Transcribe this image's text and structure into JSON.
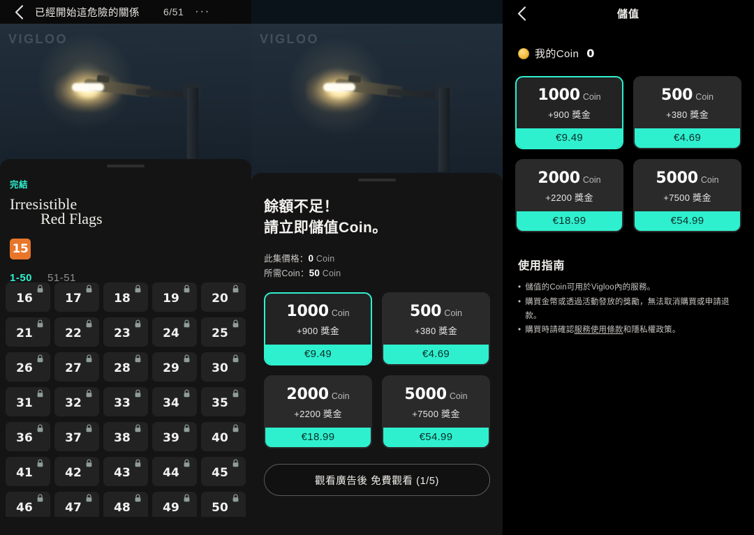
{
  "left_panel": {
    "topbar": {
      "back_icon": "chevron-left-icon",
      "title": "已經開始這危險的關係",
      "progress": "6/51",
      "more_icon": "ellipsis-icon"
    },
    "hero": {
      "watermark": "VIGLOO",
      "scene": "night-streetlamp"
    },
    "status_badge": "完結",
    "series_title_line1": "Irresistible",
    "series_title_line2": "Red Flags",
    "age_rating": "15",
    "range_tabs": [
      {
        "label": "1-50",
        "active": true
      },
      {
        "label": "51-51",
        "active": false
      }
    ],
    "episodes": [
      {
        "num": "16",
        "locked": true
      },
      {
        "num": "17",
        "locked": true
      },
      {
        "num": "18",
        "locked": true
      },
      {
        "num": "19",
        "locked": true
      },
      {
        "num": "20",
        "locked": true
      },
      {
        "num": "21",
        "locked": true
      },
      {
        "num": "22",
        "locked": true
      },
      {
        "num": "23",
        "locked": true
      },
      {
        "num": "24",
        "locked": true
      },
      {
        "num": "25",
        "locked": true
      },
      {
        "num": "26",
        "locked": true
      },
      {
        "num": "27",
        "locked": true
      },
      {
        "num": "28",
        "locked": true
      },
      {
        "num": "29",
        "locked": true
      },
      {
        "num": "30",
        "locked": true
      },
      {
        "num": "31",
        "locked": true
      },
      {
        "num": "32",
        "locked": true
      },
      {
        "num": "33",
        "locked": true
      },
      {
        "num": "34",
        "locked": true
      },
      {
        "num": "35",
        "locked": true
      },
      {
        "num": "36",
        "locked": true
      },
      {
        "num": "37",
        "locked": true
      },
      {
        "num": "38",
        "locked": true
      },
      {
        "num": "39",
        "locked": true
      },
      {
        "num": "40",
        "locked": true
      },
      {
        "num": "41",
        "locked": true
      },
      {
        "num": "42",
        "locked": true
      },
      {
        "num": "43",
        "locked": true
      },
      {
        "num": "44",
        "locked": true
      },
      {
        "num": "45",
        "locked": true
      },
      {
        "num": "46",
        "locked": true
      },
      {
        "num": "47",
        "locked": true
      },
      {
        "num": "48",
        "locked": true
      },
      {
        "num": "49",
        "locked": true
      },
      {
        "num": "50",
        "locked": true
      }
    ]
  },
  "mid_panel": {
    "hero": {
      "watermark": "VIGLOO",
      "scene": "night-streetlamp"
    },
    "headline_line1": "餘額不足！",
    "headline_line2": "請立即儲值Coin。",
    "price_rows": [
      {
        "label": "此集價格：",
        "value": "0",
        "unit": "Coin"
      },
      {
        "label": "所需Coin：",
        "value": "50",
        "unit": "Coin"
      }
    ],
    "packages": [
      {
        "amount": "1000",
        "unit": "Coin",
        "bonus": "+900 獎金",
        "price": "€9.49",
        "selected": true
      },
      {
        "amount": "500",
        "unit": "Coin",
        "bonus": "+380 獎金",
        "price": "€4.69",
        "selected": false
      },
      {
        "amount": "2000",
        "unit": "Coin",
        "bonus": "+2200 獎金",
        "price": "€18.99",
        "selected": false
      },
      {
        "amount": "5000",
        "unit": "Coin",
        "bonus": "+7500 獎金",
        "price": "€54.99",
        "selected": false
      }
    ],
    "ad_button": "觀看廣告後 免費觀看 (1/5)"
  },
  "right_panel": {
    "topbar": {
      "back_icon": "chevron-left-icon",
      "title": "儲值"
    },
    "balance": {
      "icon": "gold-coin-icon",
      "label": "我的Coin",
      "value": "0"
    },
    "packages": [
      {
        "amount": "1000",
        "unit": "Coin",
        "bonus": "+900 獎金",
        "price": "€9.49",
        "selected": true
      },
      {
        "amount": "500",
        "unit": "Coin",
        "bonus": "+380 獎金",
        "price": "€4.69",
        "selected": false
      },
      {
        "amount": "2000",
        "unit": "Coin",
        "bonus": "+2200 獎金",
        "price": "€18.99",
        "selected": false
      },
      {
        "amount": "5000",
        "unit": "Coin",
        "bonus": "+7500 獎金",
        "price": "€54.99",
        "selected": false
      }
    ],
    "guide_title": "使用指南",
    "guide_items": [
      {
        "text": "儲值的Coin可用於Vigloo內的服務。"
      },
      {
        "text": "購買金幣或透過活動發放的獎勵，無法取消購買或申請退款。"
      },
      {
        "pre": "購買時請確認",
        "link": "服務使用條款",
        "post": "和隱私權政策。"
      }
    ]
  },
  "colors": {
    "accent": "#2EF0CF",
    "badge_orange": "#E8762A",
    "sheet_bg": "#141414",
    "tile_bg": "#222222",
    "page_bg": "#000000"
  }
}
